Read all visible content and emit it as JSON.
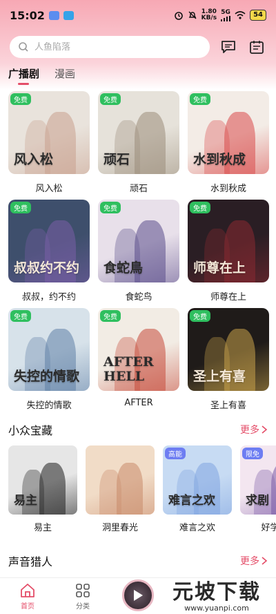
{
  "status": {
    "time": "15:02",
    "net_speed_top": "1.80",
    "net_speed_bottom": "KB/s",
    "signal": "5G",
    "battery": "54"
  },
  "search": {
    "placeholder": "人鱼陷落"
  },
  "tabs": [
    {
      "label": "广播剧",
      "active": true
    },
    {
      "label": "漫画",
      "active": false
    }
  ],
  "dramas": [
    {
      "title": "风入松",
      "badge": "免费",
      "cover_text": "风入松",
      "palette": [
        "#e9e3dc",
        "#c9a18e"
      ]
    },
    {
      "title": "顽石",
      "badge": "免费",
      "cover_text": "顽石",
      "palette": [
        "#e6e2da",
        "#9a8d7a"
      ]
    },
    {
      "title": "水到秋成",
      "badge": "免费",
      "cover_text": "水到秋成",
      "palette": [
        "#f3ece6",
        "#d94a4a"
      ]
    },
    {
      "title": "叔叔，约不约",
      "badge": "免费",
      "cover_text": "叔叔约不约",
      "palette": [
        "#3e4f6c",
        "#7a5ea8"
      ]
    },
    {
      "title": "食蛇鸟",
      "badge": "免费",
      "cover_text": "食蛇鳥",
      "palette": [
        "#e8e0ea",
        "#5a4c8a"
      ]
    },
    {
      "title": "师尊在上",
      "badge": "免费",
      "cover_text": "师尊在上",
      "palette": [
        "#2a1e24",
        "#8a2a32"
      ]
    },
    {
      "title": "失控的情歌",
      "badge": "免费",
      "cover_text": "失控的情歌",
      "palette": [
        "#d7e2ea",
        "#5f7fa6"
      ]
    },
    {
      "title": "AFTER",
      "badge": "免费",
      "cover_text": "AFTER HELL",
      "palette": [
        "#f2ece4",
        "#c64a3a"
      ]
    },
    {
      "title": "圣上有喜",
      "badge": "免费",
      "cover_text": "圣上有喜",
      "palette": [
        "#1f1b19",
        "#c9a34a"
      ]
    }
  ],
  "section_niche": {
    "title": "小众宝藏",
    "more": "更多"
  },
  "niche_items": [
    {
      "title": "易主",
      "badge": "",
      "cover_text": "易主",
      "palette": [
        "#e6e6e6",
        "#1f1f1f"
      ]
    },
    {
      "title": "洞里春光",
      "badge": "",
      "cover_text": "",
      "palette": [
        "#f1dcc7",
        "#c98a6a"
      ]
    },
    {
      "title": "难言之欢",
      "badge": "高能",
      "cover_text": "难言之欢",
      "palette": [
        "#c7dbf3",
        "#7fa4e0"
      ]
    },
    {
      "title": "好学的",
      "badge": "限免",
      "cover_text": "求剧",
      "palette": [
        "#f3e6f0",
        "#7a5aa6"
      ]
    }
  ],
  "section_hunter": {
    "title": "声音猎人",
    "more": "更多"
  },
  "nav": {
    "home": "首页",
    "category": "分类"
  },
  "watermark": {
    "main": "元坡下载",
    "sub": "www.yuanpi.com"
  },
  "colors": {
    "accent": "#e44d68",
    "badge_free": "#2fbf5f",
    "top_gradient": "#f7a8b4"
  }
}
